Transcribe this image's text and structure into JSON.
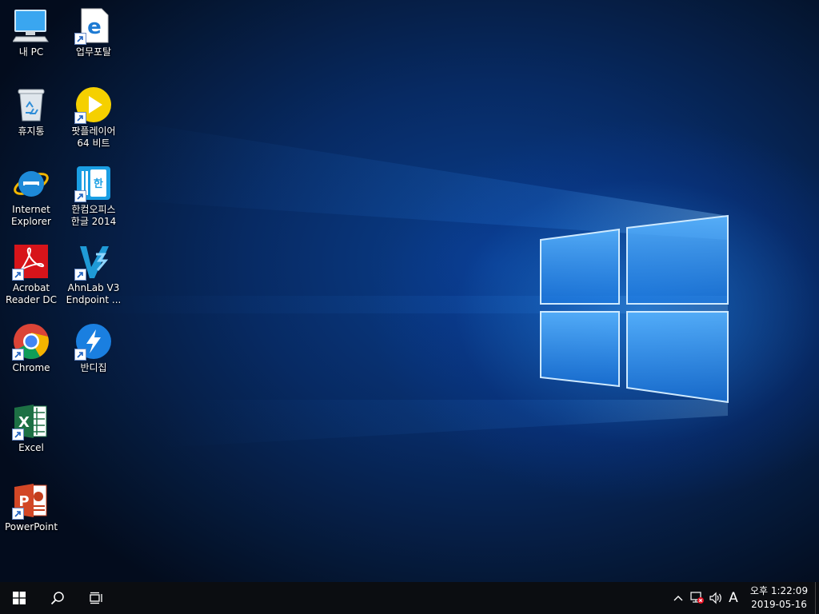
{
  "desktop_icons": [
    {
      "label": "내 PC",
      "icon": "this-pc-icon"
    },
    {
      "label": "업무포탈",
      "icon": "edge-file-icon"
    },
    {
      "label": "휴지통",
      "icon": "recycle-bin-icon"
    },
    {
      "label": "팟플레이어\n64 비트",
      "icon": "potplayer-icon"
    },
    {
      "label": "Internet\nExplorer",
      "icon": "internet-explorer-icon"
    },
    {
      "label": "한컴오피스\n한글 2014",
      "icon": "hancom-office-icon"
    },
    {
      "label": "Acrobat\nReader DC",
      "icon": "acrobat-reader-icon"
    },
    {
      "label": "AhnLab V3\nEndpoint ...",
      "icon": "ahnlab-v3-icon"
    },
    {
      "label": "Chrome",
      "icon": "chrome-icon"
    },
    {
      "label": "반디집",
      "icon": "bandizip-icon"
    },
    {
      "label": "Excel",
      "icon": "excel-icon"
    },
    {
      "label": "PowerPoint",
      "icon": "powerpoint-icon"
    }
  ],
  "taskbar": {
    "start": "windows-start-icon",
    "search": "search-icon",
    "task_view": "task-view-icon",
    "tray": {
      "chevron": "chevron-up-icon",
      "network": "network-disconnected-icon",
      "volume": "speaker-icon",
      "ime": "A"
    },
    "clock": {
      "time": "오후 1:22:09",
      "date": "2019-05-16"
    }
  },
  "colors": {
    "wallpaper_blue": "#0a3f8f",
    "taskbar": "#0b0d11",
    "logo_glow": "#4fb0ff"
  }
}
